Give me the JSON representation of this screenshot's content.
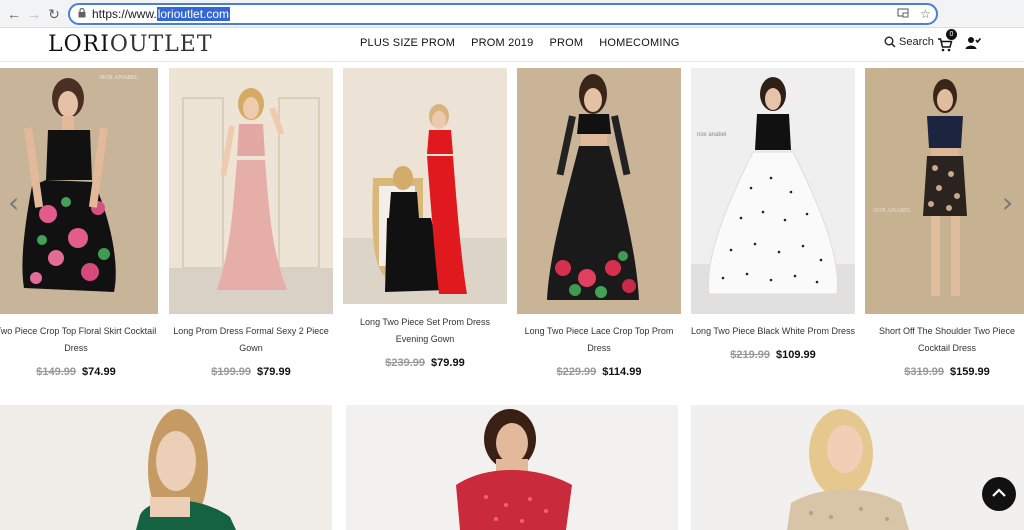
{
  "browser": {
    "url_prefix": "https://www.",
    "url_domain": "lorioutlet.com"
  },
  "site": {
    "logo_bold": "LORI",
    "logo_thin": "OUTLET",
    "nav": [
      "PLUS SIZE PROM",
      "PROM 2019",
      "PROM",
      "HOMECOMING"
    ],
    "search_label": "Search",
    "cart_count": "0"
  },
  "products": [
    {
      "title": "Two Piece Crop Top Floral Skirt Cocktail Dress",
      "old_price": "$149.99",
      "price": "$74.99",
      "brand_mark": "NOX ANABEL"
    },
    {
      "title": "Long Prom Dress Formal Sexy 2 Piece Gown",
      "old_price": "$199.99",
      "price": "$79.99"
    },
    {
      "title": "Long Two Piece Set Prom Dress Evening Gown",
      "old_price": "$239.99",
      "price": "$79.99"
    },
    {
      "title": "Long Two Piece Lace Crop Top Prom Dress",
      "old_price": "$229.99",
      "price": "$114.99"
    },
    {
      "title": "Long Two Piece Black White Prom Dress",
      "old_price": "$219.99",
      "price": "$109.99",
      "brand_mark": "nox anabel"
    },
    {
      "title": "Short Off The Shoulder Two Piece Cocktail Dress",
      "old_price": "$319.99",
      "price": "$159.99",
      "brand_mark": "NOX ANABEL"
    }
  ],
  "colors": {
    "omnibox_border": "#4a7fd9",
    "price_old": "#999999",
    "price_new": "#111111"
  }
}
